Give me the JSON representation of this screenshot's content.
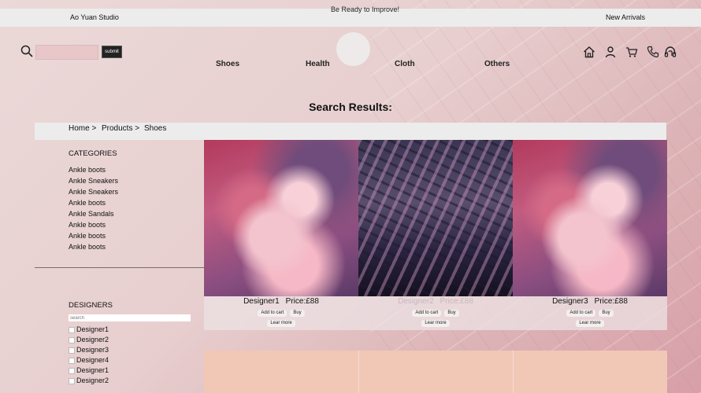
{
  "topbar": {
    "brand": "Ao Yuan Studio",
    "promo": "Be Ready to Improve!",
    "new_arrivals": "New Arrivals"
  },
  "search": {
    "placeholder": "",
    "submit_label": "submit"
  },
  "nav": {
    "items": [
      "Shoes",
      "Health",
      "Cloth",
      "Others"
    ]
  },
  "header_icons": [
    "home-icon",
    "user-icon",
    "cart-icon",
    "phone-icon",
    "support-icon"
  ],
  "results_title": "Search Results:",
  "breadcrumb": {
    "home": "Home >",
    "products": "Products >",
    "current": "Shoes"
  },
  "categories": {
    "heading": "CATEGORIES",
    "items": [
      "Ankle boots",
      "Ankle Sneakers",
      "Ankle Sneakers",
      "Ankle boots",
      "Ankle Sandals",
      "Ankle boots",
      "Ankle boots",
      "Ankle boots"
    ]
  },
  "designers": {
    "heading": "DESIGNERS",
    "search_placeholder": "search",
    "items": [
      "Designer1",
      "Designer2",
      "Designer3",
      "Designer4",
      "Designer1",
      "Designer2"
    ]
  },
  "products": [
    {
      "name": "Designer1",
      "price": "Price:£88",
      "add_to_cart": "Add to cart",
      "buy": "Buy",
      "learn_more": "Lear more",
      "image": "pink-smoke"
    },
    {
      "name": "Designer2",
      "price": "Price:£88",
      "add_to_cart": "Add to cart",
      "buy": "Buy",
      "learn_more": "Lear more",
      "image": "building-facade"
    },
    {
      "name": "Designer3",
      "price": "Price:£88",
      "add_to_cart": "Add to cart",
      "buy": "Buy",
      "learn_more": "Lear more",
      "image": "pink-smoke"
    }
  ],
  "colors": {
    "topbar_bg": "#ececec",
    "submit_bg": "#222222",
    "peach_tiles": "#f1c7b6"
  }
}
